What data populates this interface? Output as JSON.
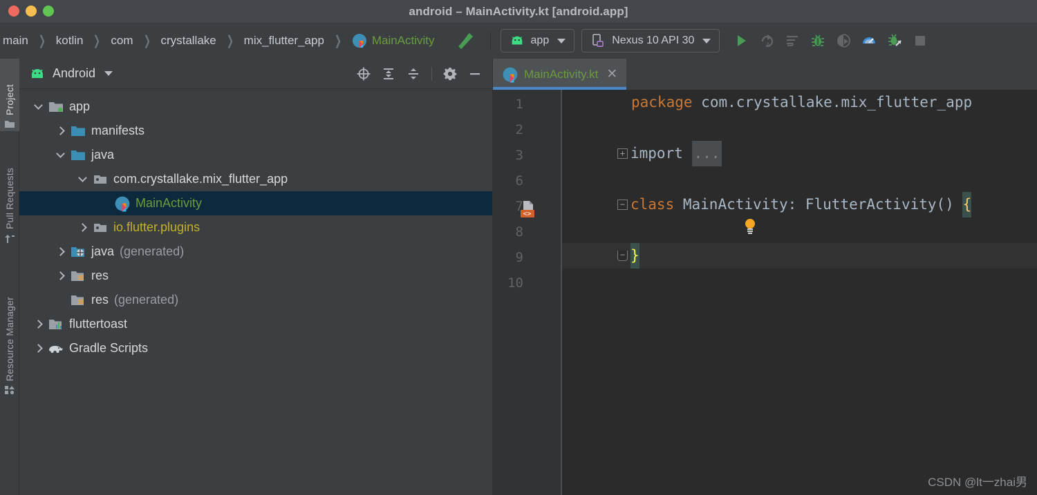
{
  "window": {
    "title": "android – MainActivity.kt [android.app]",
    "traffic_lights": [
      "close",
      "minimize",
      "zoom"
    ],
    "colors": {
      "titlebar_bg": "#43464a",
      "panel_bg": "#3c3f41",
      "editor_bg": "#2b2b2b",
      "gutter_bg": "#313335",
      "selection_bg": "#0d293e",
      "tab_underline": "#4a88c7",
      "kotlin_green": "#6a9b3f",
      "keyword_orange": "#cc7832",
      "accent_green": "#499c54"
    }
  },
  "toolbar": {
    "breadcrumbs": [
      "main",
      "kotlin",
      "com",
      "crystallake",
      "mix_flutter_app",
      "MainActivity"
    ],
    "breadcrumb_separator": "〉",
    "build_icon": "hammer-icon",
    "run_config": {
      "label": "app",
      "icon": "android-icon"
    },
    "device": {
      "label": "Nexus 10 API 30",
      "icon": "device-tablet-icon"
    },
    "actions": [
      {
        "name": "run-button",
        "icon": "play-icon"
      },
      {
        "name": "apply-changes-button",
        "icon": "apply-code-changes-icon"
      },
      {
        "name": "apply-code-changes-button",
        "icon": "apply-changes-icon"
      },
      {
        "name": "debug-button",
        "icon": "bug-icon"
      },
      {
        "name": "attach-debugger-button",
        "icon": "attach-debugger-icon"
      },
      {
        "name": "profiler-button",
        "icon": "profiler-icon"
      },
      {
        "name": "run-with-coverage-button",
        "icon": "coverage-icon"
      },
      {
        "name": "stop-button",
        "icon": "stop-icon"
      }
    ]
  },
  "leftbar": {
    "tabs": [
      {
        "label": "Project",
        "icon": "folder-icon",
        "active": true
      },
      {
        "label": "Pull Requests",
        "icon": "pull-request-icon",
        "active": false
      },
      {
        "label": "Resource Manager",
        "icon": "resource-manager-icon",
        "active": false
      }
    ]
  },
  "project_panel": {
    "title": "Android",
    "title_icon": "android-icon",
    "dropdown_icon": "chevron-down-icon",
    "actions": [
      {
        "name": "select-opened-file-button",
        "icon": "target-icon"
      },
      {
        "name": "expand-all-button",
        "icon": "expand-all-icon"
      },
      {
        "name": "collapse-all-button",
        "icon": "collapse-all-icon"
      },
      {
        "name": "settings-button",
        "icon": "gear-icon"
      },
      {
        "name": "hide-button",
        "icon": "minus-icon"
      }
    ],
    "tree": [
      {
        "label": "app",
        "sub": "",
        "depth": 0,
        "arrow": "down",
        "icon": "module-folder-icon",
        "style": "plain",
        "selected": false
      },
      {
        "label": "manifests",
        "sub": "",
        "depth": 1,
        "arrow": "right",
        "icon": "folder-blue-icon",
        "style": "plain",
        "selected": false
      },
      {
        "label": "java",
        "sub": "",
        "depth": 1,
        "arrow": "down",
        "icon": "folder-blue-icon",
        "style": "plain",
        "selected": false
      },
      {
        "label": "com.crystallake.mix_flutter_app",
        "sub": "",
        "depth": 2,
        "arrow": "down",
        "icon": "package-icon",
        "style": "plain",
        "selected": false
      },
      {
        "label": "MainActivity",
        "sub": "",
        "depth": 3,
        "arrow": "none",
        "icon": "kotlin-class-icon",
        "style": "kt",
        "selected": true
      },
      {
        "label": "io.flutter.plugins",
        "sub": "",
        "depth": 2,
        "arrow": "right",
        "icon": "package-icon",
        "style": "yellow",
        "selected": false
      },
      {
        "label": "java",
        "sub": "(generated)",
        "depth": 1,
        "arrow": "right",
        "icon": "folder-generated-icon",
        "style": "plain",
        "selected": false
      },
      {
        "label": "res",
        "sub": "",
        "depth": 1,
        "arrow": "right",
        "icon": "folder-res-icon",
        "style": "plain",
        "selected": false
      },
      {
        "label": "res",
        "sub": "(generated)",
        "depth": 1,
        "arrow": "none",
        "icon": "folder-res-icon",
        "style": "plain",
        "selected": false
      },
      {
        "label": "fluttertoast",
        "sub": "",
        "depth": 0,
        "arrow": "right",
        "icon": "library-module-icon",
        "style": "plain",
        "selected": false
      },
      {
        "label": "Gradle Scripts",
        "sub": "",
        "depth": 0,
        "arrow": "right",
        "icon": "gradle-elephant-icon",
        "style": "plain",
        "selected": false
      }
    ]
  },
  "editor": {
    "tab": {
      "label": "MainActivity.kt",
      "icon": "kotlin-class-icon",
      "close_icon": "close-icon"
    },
    "line_numbers": [
      "1",
      "2",
      "3",
      "6",
      "7",
      "8",
      "9",
      "10"
    ],
    "lines": [
      {
        "num": "1",
        "content": "package com.crystallake.mix_flutter_app"
      },
      {
        "num": "2",
        "content": ""
      },
      {
        "num": "3",
        "content": "import ..."
      },
      {
        "num": "6",
        "content": ""
      },
      {
        "num": "7",
        "content": "class MainActivity: FlutterActivity() {"
      },
      {
        "num": "8",
        "content": ""
      },
      {
        "num": "9",
        "content": "}"
      },
      {
        "num": "10",
        "content": ""
      }
    ],
    "tokens": {
      "package_keyword": "package",
      "package_name": "com.crystallake.mix_flutter_app",
      "import_keyword": "import",
      "import_fold": "...",
      "class_keyword": "class",
      "class_signature": "MainActivity: FlutterActivity()",
      "open_brace": "{",
      "close_brace": "}"
    },
    "gutter_icons": [
      {
        "line": "7",
        "name": "kotlin-class-gutter-icon"
      },
      {
        "line": "8",
        "name": "intention-bulb-icon"
      }
    ]
  },
  "watermark": {
    "text": "CSDN @lt一zhai男"
  }
}
